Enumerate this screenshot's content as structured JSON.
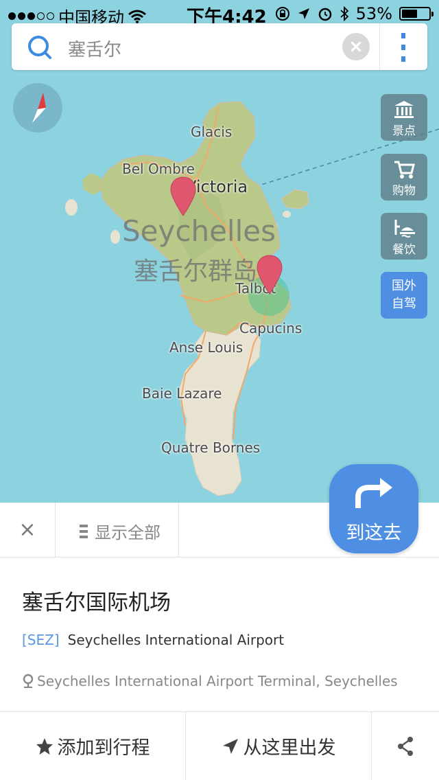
{
  "status_bar": {
    "signal_dots": "●●●○○",
    "carrier": "中国移动",
    "wifi_icon": "wifi-icon",
    "time": "下午4:42",
    "battery": "53%",
    "battery_level": 0.53
  },
  "search": {
    "query": "塞舌尔",
    "search_icon": "search-icon",
    "clear_icon": "clear-icon",
    "more_icon": "more-vertical-icon"
  },
  "map": {
    "compass_icon": "compass-icon",
    "labels": {
      "glacis": "Glacis",
      "bel_ombre": "Bel Ombre",
      "victoria": "Victoria",
      "seychelles_en": "Seychelles",
      "seychelles_cn": "塞舌尔群岛",
      "talbot": "Talbot",
      "capucins": "Capucins",
      "anse_louis": "Anse Louis",
      "baie_lazare": "Baie Lazare",
      "quatre_bornes": "Quatre Bornes"
    },
    "colors": {
      "water": "#8dd2df",
      "land_green": "#b9c98a",
      "land_sand": "#e8e2d0",
      "pin": "#e0566e",
      "accent": "#4f8fe3"
    }
  },
  "categories": {
    "scenic": "景点",
    "shopping": "购物",
    "dining": "餐饮",
    "self_drive_line1": "国外",
    "self_drive_line2": "自驾"
  },
  "go_button": {
    "label": "到这去"
  },
  "toolbar": {
    "close": "×",
    "show_all": "显示全部"
  },
  "place": {
    "name": "塞舌尔国际机场",
    "code": "[SEZ]",
    "english_name": "Seychelles International Airport",
    "address": "Seychelles International Airport Terminal, Seychelles"
  },
  "actions": {
    "add_to_trip": "添加到行程",
    "depart_from_here": "从这里出发",
    "share_icon": "share-icon"
  }
}
